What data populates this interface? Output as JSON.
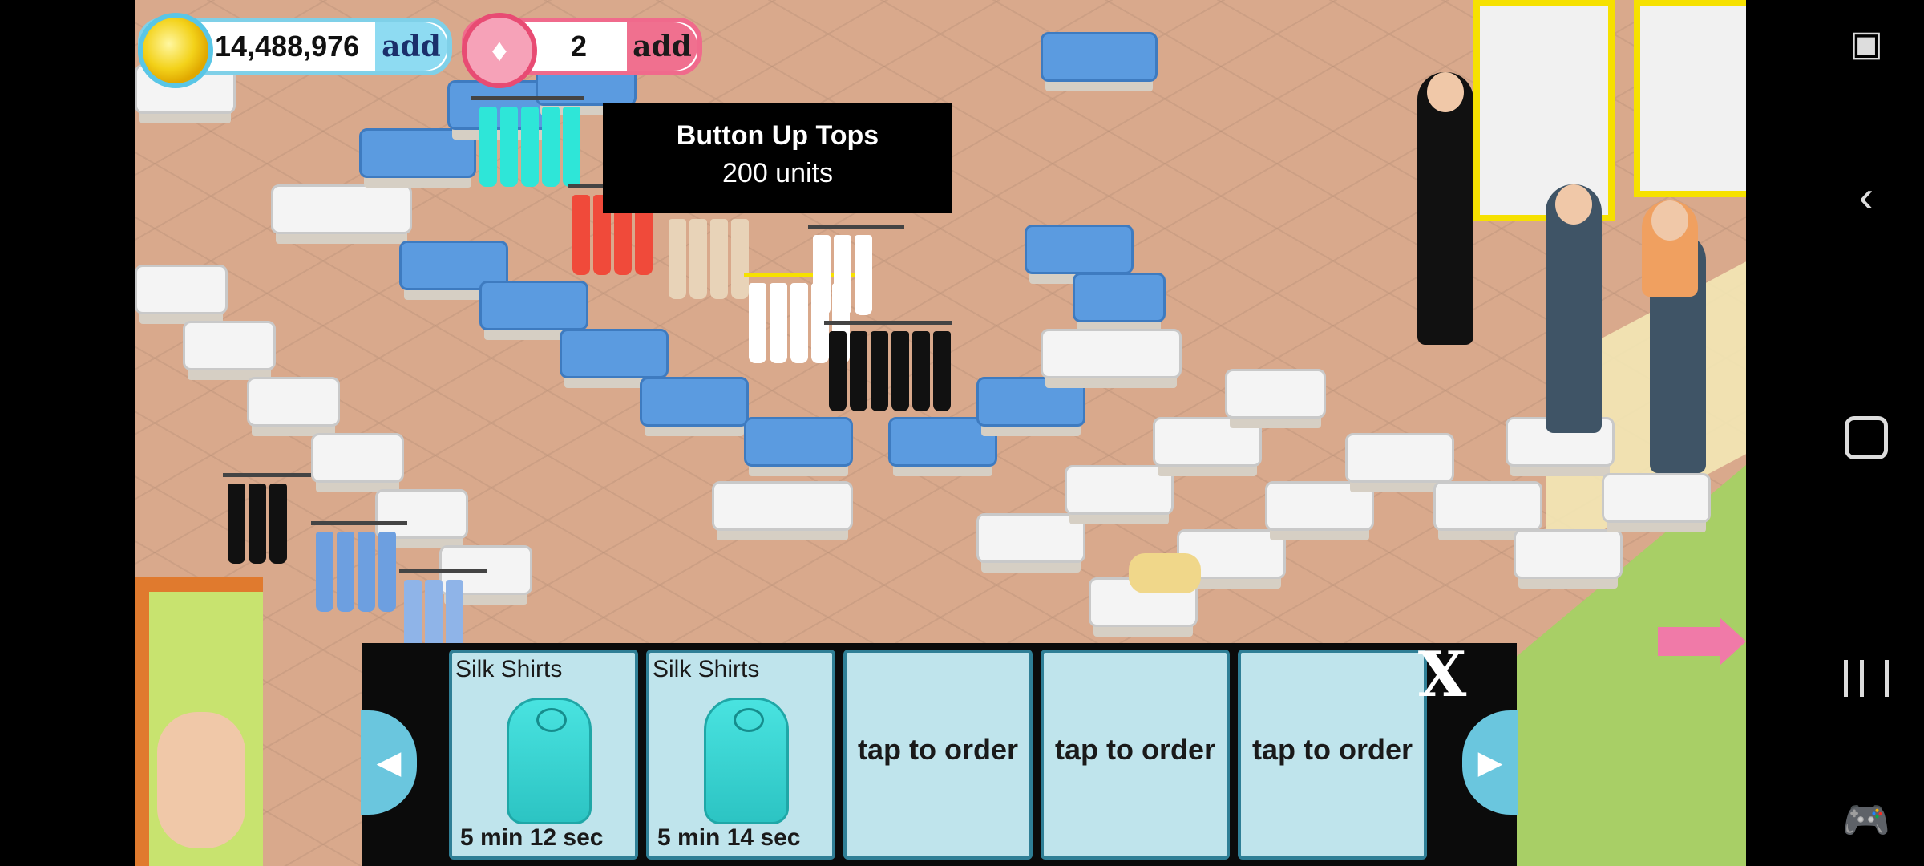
{
  "hud": {
    "coins": "14,488,976",
    "coins_add": "add",
    "gems": "2",
    "gems_add": "add"
  },
  "tooltip": {
    "title": "Button Up Tops",
    "units": "200 units"
  },
  "tray": {
    "slots": [
      {
        "title": "Silk Shirts",
        "time": "5 min 12 sec",
        "icon": "silk-shirt-icon"
      },
      {
        "title": "Silk Shirts",
        "time": "5 min 14 sec",
        "icon": "silk-shirt-icon"
      },
      {
        "empty": "tap to order"
      },
      {
        "empty": "tap to order"
      },
      {
        "empty": "tap to order"
      }
    ],
    "close_label": "X"
  },
  "colors": {
    "floor": "#d9a98c",
    "slot_bg": "#bfe4ec",
    "shirt": "#2cc4c3",
    "coin_ring": "#59c6e6",
    "gem_ring": "#e84b73"
  }
}
